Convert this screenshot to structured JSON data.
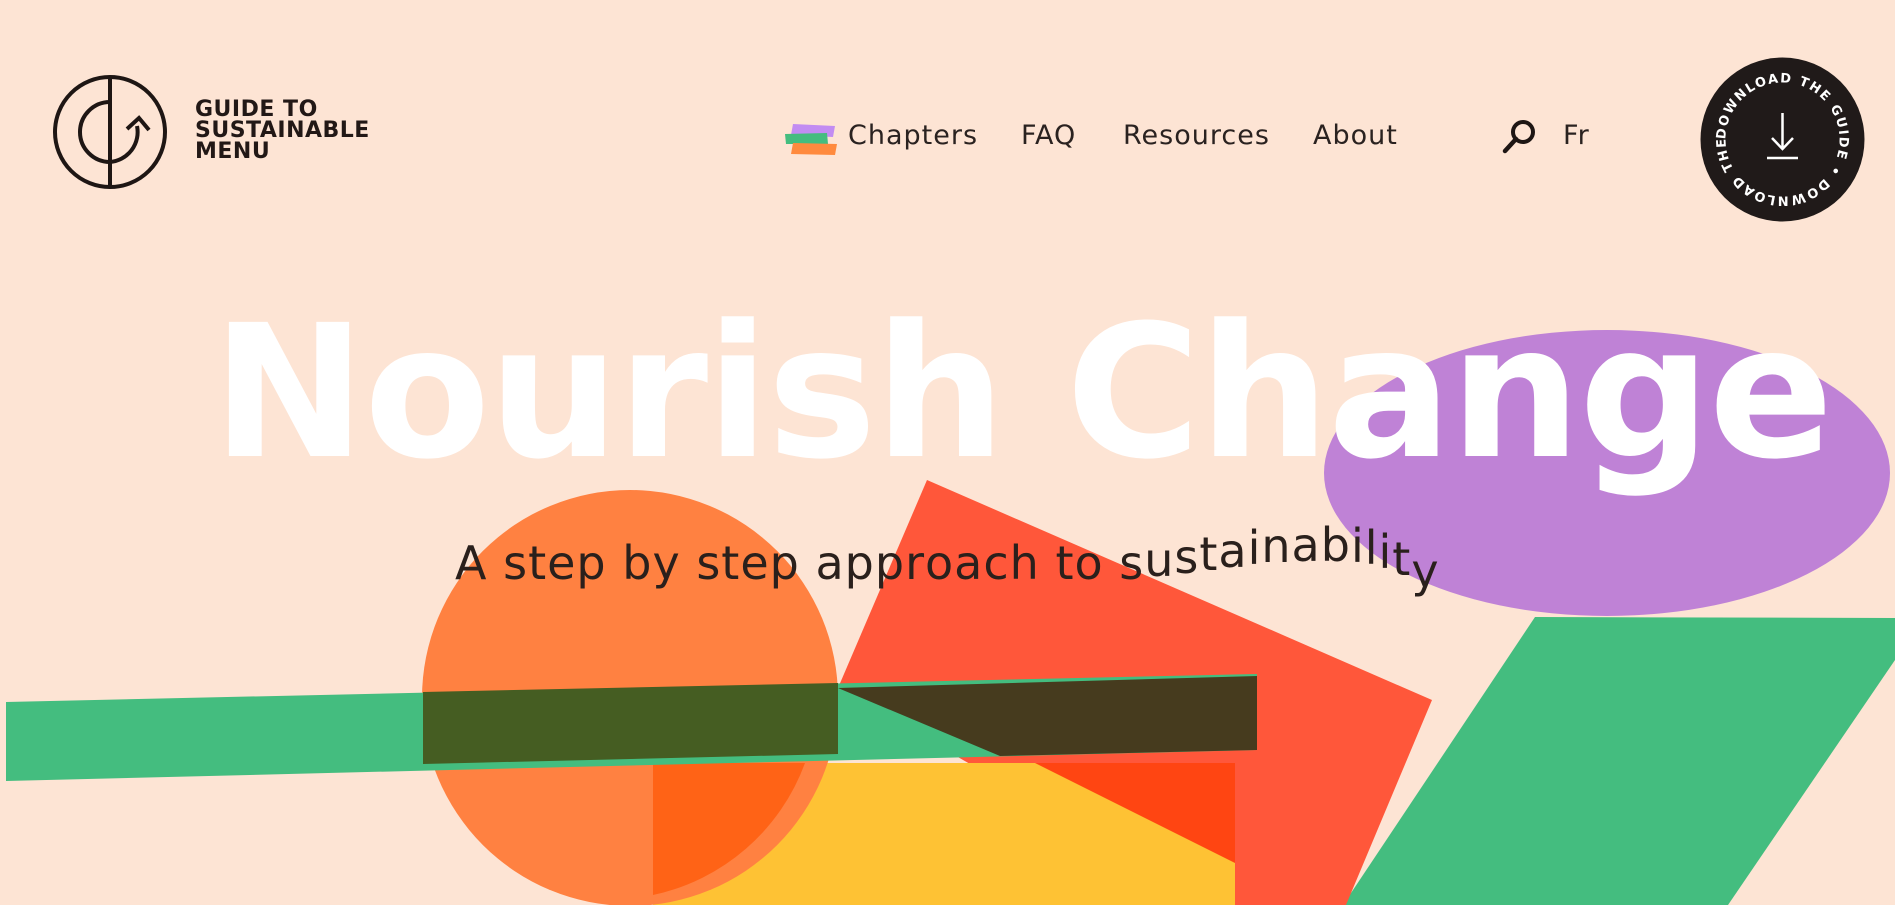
{
  "brand": {
    "line1": "GUIDE TO",
    "line2": "SUSTAINABLE",
    "line3": "MENU"
  },
  "nav": {
    "chapters": "Chapters",
    "faq": "FAQ",
    "resources": "Resources",
    "about": "About",
    "language": "Fr"
  },
  "download": {
    "ring_text": "DOWNLOAD THE GUIDE • DOWNLOAD THE GUIDE • "
  },
  "hero": {
    "headline": "Nourish Change",
    "subtitle": "A step by step approach to sustainability"
  },
  "colors": {
    "background": "#fde4d4",
    "green": "#44bd7f",
    "purple": "#bf82d6",
    "orange": "#ff8141",
    "red": "#ff573a",
    "yellow": "#fec234",
    "dark": "#201a19"
  }
}
